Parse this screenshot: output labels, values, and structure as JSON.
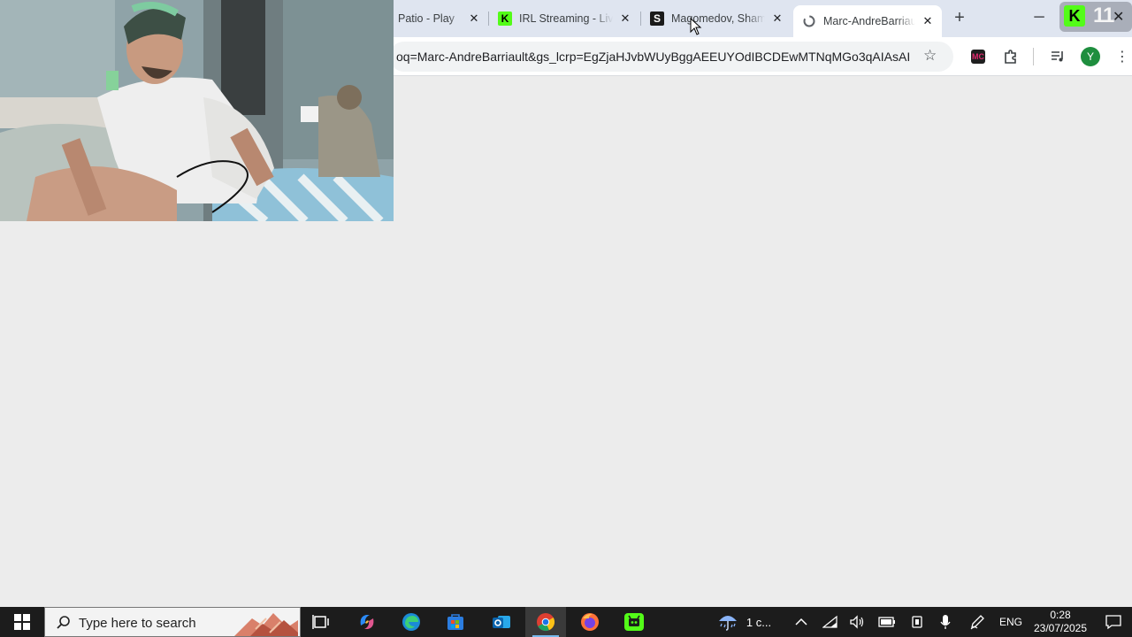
{
  "browser": {
    "tabs": [
      {
        "title": "Patio - Play",
        "favicon": "patio-favicon"
      },
      {
        "title": "IRL Streaming - Live",
        "favicon": "kick-favicon"
      },
      {
        "title": "Magomedov, Shamil",
        "favicon": "sherdog-favicon"
      },
      {
        "title": "Marc-AndreBarriault",
        "favicon": "google-favicon"
      }
    ],
    "active_tab": 3,
    "url": "oq=Marc-AndreBarriault&gs_lcrp=EgZjaHJvbWUyBggAEEUYOdIBCDEwMTNqMGo3qAIAsAIA...",
    "profile_initial": "Y",
    "extension_label": "MC"
  },
  "overlay": {
    "viewer_count": "11"
  },
  "taskbar": {
    "search_placeholder": "Type here to search",
    "weather": "1 c...",
    "language": "ENG",
    "time": "0:28",
    "date": "23/07/2025"
  },
  "colors": {
    "kick_green": "#53fc18",
    "taskbar_bg": "#1c1c1c",
    "page_bg": "#ececec",
    "tabstrip_bg": "#dfe5f0"
  }
}
